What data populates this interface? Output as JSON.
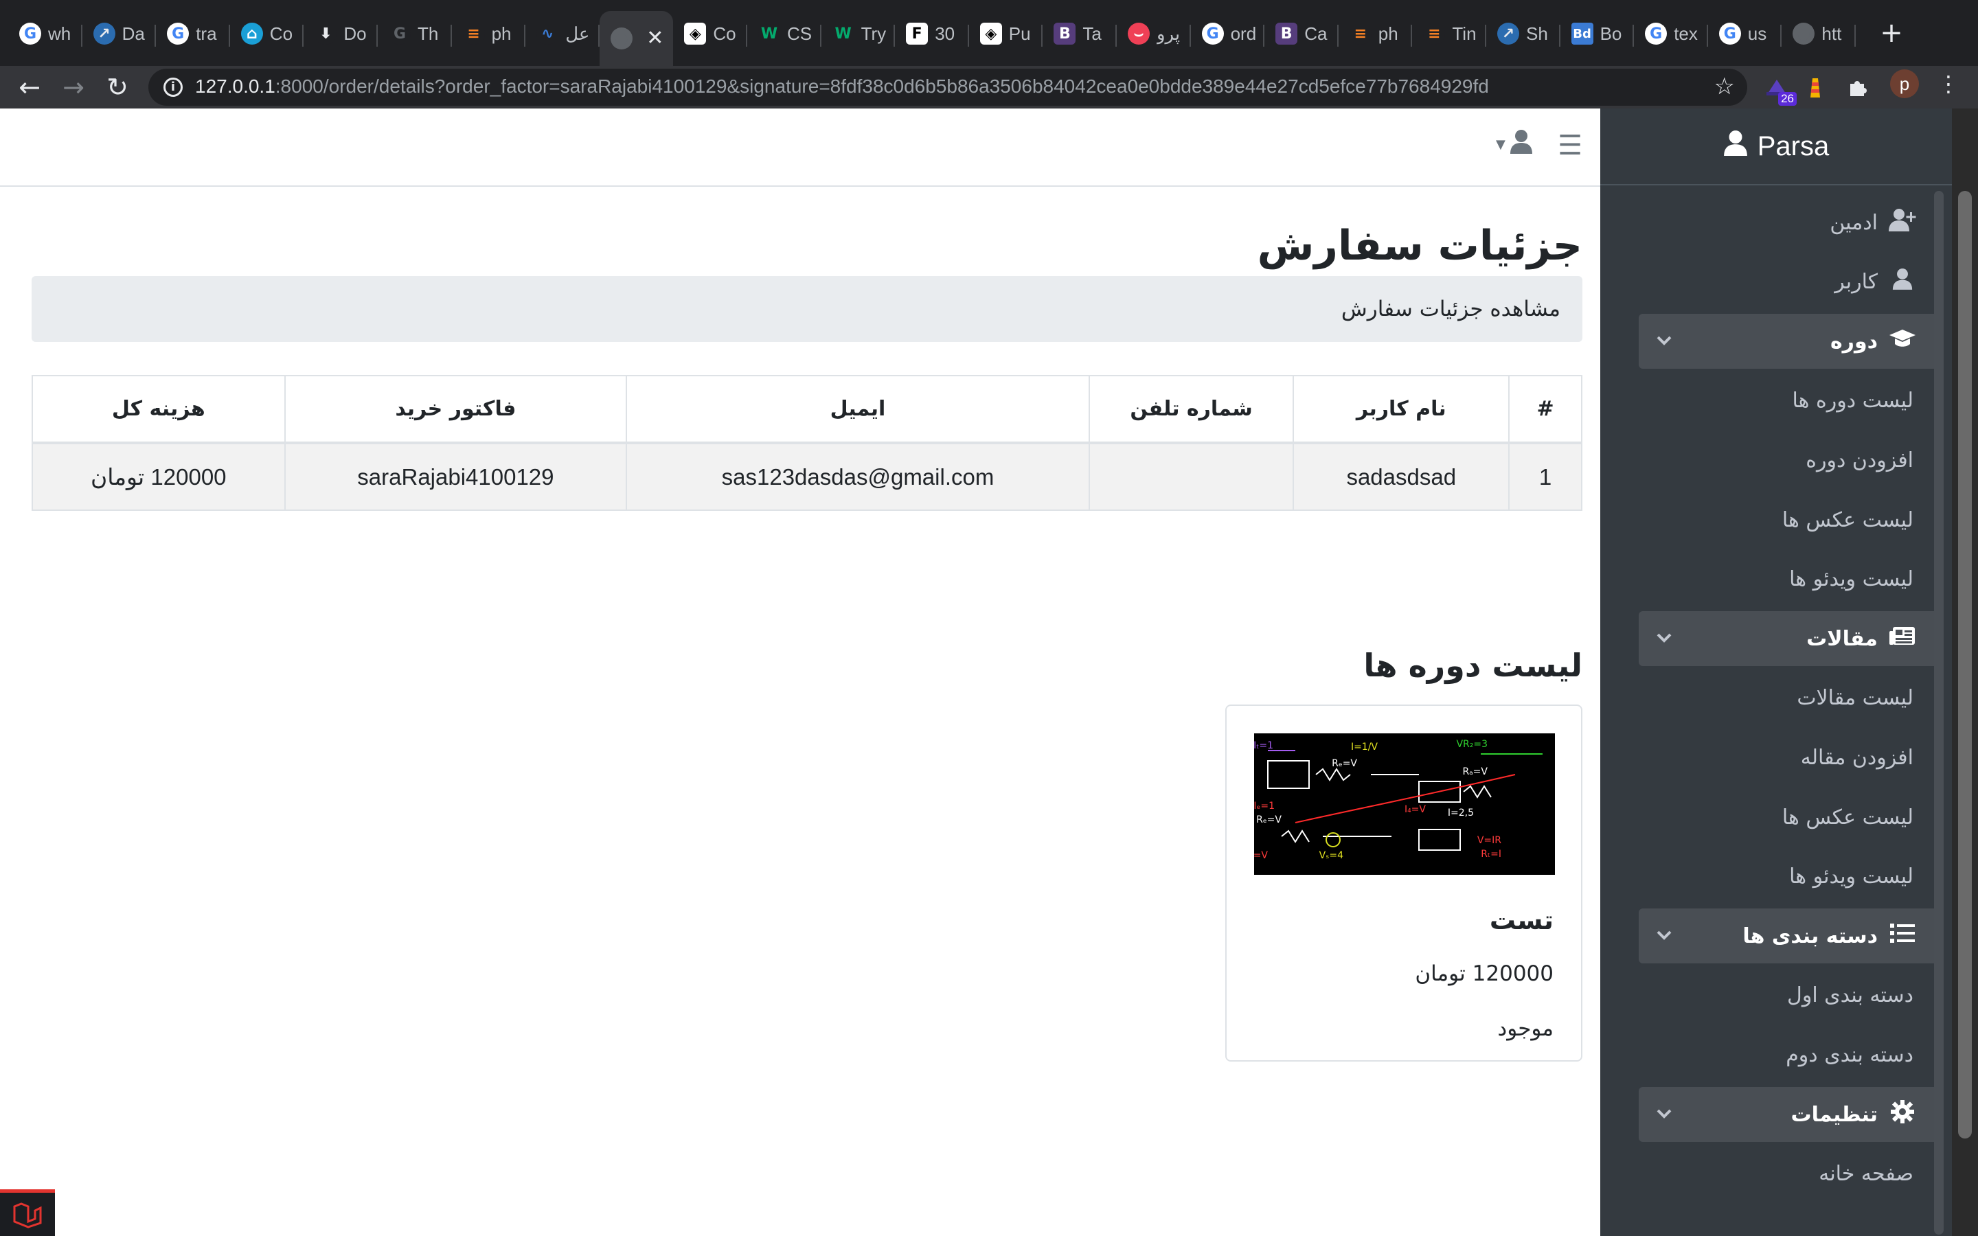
{
  "browser": {
    "tabs": [
      {
        "favicon": "google-icon",
        "title": "wh"
      },
      {
        "favicon": "rocket-icon",
        "title": "Da"
      },
      {
        "favicon": "google-icon",
        "title": "tra"
      },
      {
        "favicon": "home-icon",
        "title": "Co"
      },
      {
        "favicon": "download-icon",
        "title": "Do"
      },
      {
        "favicon": "grammarly-icon",
        "title": "Th"
      },
      {
        "favicon": "stackoverflow-icon",
        "title": "ph"
      },
      {
        "favicon": "waveform-icon",
        "title": "عل"
      },
      {
        "favicon": "globe-icon",
        "title": ""
      },
      {
        "favicon": "codepen-icon",
        "title": "Co"
      },
      {
        "favicon": "w3schools-icon",
        "title": "CS"
      },
      {
        "favicon": "w3schools-icon",
        "title": "Try"
      },
      {
        "favicon": "f-icon",
        "title": "30"
      },
      {
        "favicon": "codepen-icon",
        "title": "Pu"
      },
      {
        "favicon": "bootstrap-icon",
        "title": "Ta"
      },
      {
        "favicon": "pocket-icon",
        "title": "پرو"
      },
      {
        "favicon": "google-icon",
        "title": "ord"
      },
      {
        "favicon": "bootstrap-icon",
        "title": "Ca"
      },
      {
        "favicon": "stackoverflow-icon",
        "title": "ph"
      },
      {
        "favicon": "stackoverflow-icon",
        "title": "Tin"
      },
      {
        "favicon": "rocket-icon",
        "title": "Sh"
      },
      {
        "favicon": "bd-icon",
        "title": "Bo"
      },
      {
        "favicon": "google-icon",
        "title": "tex"
      },
      {
        "favicon": "google-icon",
        "title": "us"
      },
      {
        "favicon": "globe-icon",
        "title": "htt"
      }
    ],
    "active_tab_index": 8,
    "url_host": "127.0.0.1",
    "url_rest": ":8000/order/details?order_factor=saraRajabi4100129&signature=8fdf38c0d6b5b86a3506b84042cea0e0bdde389e44e27cd5efce77b7684929fd",
    "extension_badge": "26",
    "profile_initial": "p",
    "colors": {
      "tabstrip": "#202124",
      "toolbar": "#35363a",
      "omnibox": "#202124"
    }
  },
  "sidebar": {
    "brand": "Parsa",
    "items": [
      {
        "label": "ادمین",
        "icon": "user-plus-icon",
        "kind": "link"
      },
      {
        "label": "کاربر",
        "icon": "user-icon",
        "kind": "link"
      },
      {
        "label": "دوره",
        "icon": "graduation-cap-icon",
        "kind": "group"
      },
      {
        "label": "لیست دوره ها",
        "kind": "sub"
      },
      {
        "label": "افزودن دوره",
        "kind": "sub"
      },
      {
        "label": "لیست عکس ها",
        "kind": "sub"
      },
      {
        "label": "لیست ویدئو ها",
        "kind": "sub"
      },
      {
        "label": "مقالات",
        "icon": "newspaper-icon",
        "kind": "group"
      },
      {
        "label": "لیست مقالات",
        "kind": "sub"
      },
      {
        "label": "افزودن مقاله",
        "kind": "sub"
      },
      {
        "label": "لیست عکس ها",
        "kind": "sub"
      },
      {
        "label": "لیست ویدئو ها",
        "kind": "sub"
      },
      {
        "label": "دسته بندی ها",
        "icon": "list-icon",
        "kind": "group"
      },
      {
        "label": "دسته بندی اول",
        "kind": "sub"
      },
      {
        "label": "دسته بندی دوم",
        "kind": "sub"
      },
      {
        "label": "تنظیمات",
        "icon": "gear-icon",
        "kind": "group"
      },
      {
        "label": "صفحه خانه",
        "kind": "sub"
      }
    ],
    "colors": {
      "background": "#343a40",
      "group": "#494e54",
      "text": "#c2c7d0"
    }
  },
  "main": {
    "title": "جزئیات سفارش",
    "subtitle": "مشاهده جزئیات سفارش",
    "table": {
      "headers": [
        "#",
        "نام کاربر",
        "شماره تلفن",
        "ایمیل",
        "فاکتور خرید",
        "هزینه کل"
      ],
      "rows": [
        [
          "1",
          "sadasdsad",
          "",
          "sas123dasdas@gmail.com",
          "saraRajabi4100129",
          "120000 تومان"
        ]
      ]
    },
    "courses_title": "لیست دوره ها",
    "course": {
      "name": "تست",
      "price": "120000 تومان",
      "status": "موجود"
    }
  }
}
